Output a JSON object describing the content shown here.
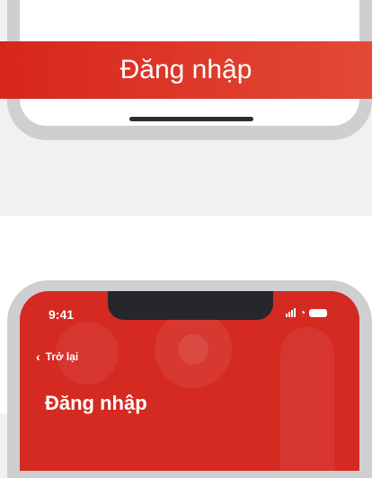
{
  "top_phone": {
    "login_label": "Đăng nhập"
  },
  "bottom_phone": {
    "status": {
      "time": "9:41",
      "icons": [
        "signal-icon",
        "wifi-icon",
        "battery-icon"
      ]
    },
    "nav": {
      "back_label": "Trở lại",
      "back_icon": "chevron-left-icon"
    },
    "title": "Đăng nhập"
  },
  "colors": {
    "brand_red": "#d42a22",
    "frame_gray": "#cfcfd2",
    "background": "#f1f1f3"
  }
}
